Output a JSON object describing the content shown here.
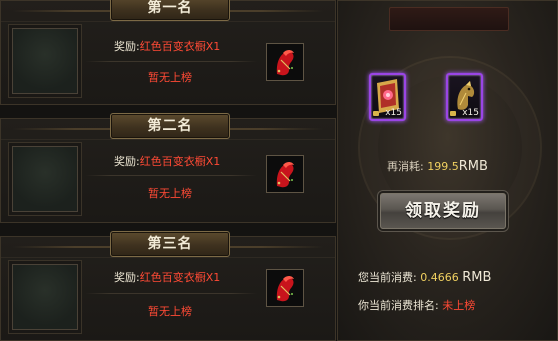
{
  "ranks": [
    {
      "title": "第一名",
      "reward_label": "奖励:",
      "reward_value": "红色百变衣橱X1",
      "status": "暂无上榜"
    },
    {
      "title": "第二名",
      "reward_label": "奖励:",
      "reward_value": "红色百变衣橱X1",
      "status": "暂无上榜"
    },
    {
      "title": "第三名",
      "reward_label": "奖励:",
      "reward_value": "红色百变衣橱X1",
      "status": "暂无上榜"
    }
  ],
  "reward_panel": {
    "items": [
      {
        "icon": "red-scroll-icon",
        "count": "x15"
      },
      {
        "icon": "golden-horse-icon",
        "count": "x15"
      }
    ],
    "spend_label": "再消耗:",
    "spend_value": "199.5",
    "spend_unit": "RMB",
    "claim_button": "领取奖励",
    "current_spend_label": "您当前消费:",
    "current_spend_value": "0.4666",
    "current_spend_unit": "RMB",
    "current_rank_label": "你当前消费排名:",
    "current_rank_value": "未上榜"
  },
  "colors": {
    "accent_red": "#ff4a35",
    "value_yellow": "#f0d060",
    "epic_purple": "#9a45e6"
  }
}
